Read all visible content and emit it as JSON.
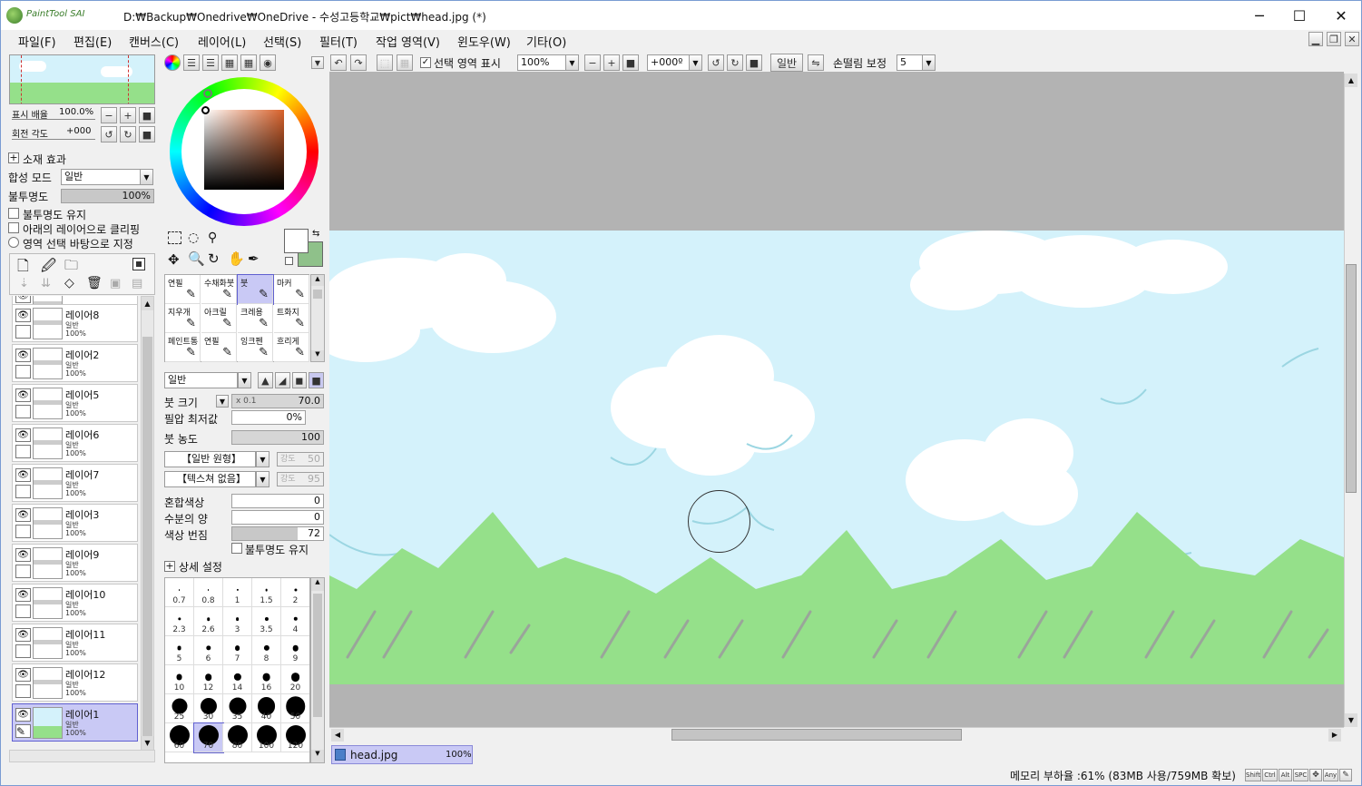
{
  "window": {
    "app_logo": "PaintTool SAI",
    "title": "D:₩Backup₩Onedrive₩OneDrive - 수성고등학교₩pict₩head.jpg (*)",
    "minimize_icon": "minimize-icon",
    "maximize_icon": "maximize-icon",
    "close_icon": "close-icon"
  },
  "menu": [
    "파일(F)",
    "편집(E)",
    "캔버스(C)",
    "레이어(L)",
    "선택(S)",
    "필터(T)",
    "작업 영역(V)",
    "윈도우(W)",
    "기타(O)"
  ],
  "navigator": {
    "zoom_label": "표시 배율",
    "zoom_value": "100.0%",
    "rotate_label": "회전 각도",
    "rotate_value": "+000"
  },
  "layer_props": {
    "effects_label": "소재 효과",
    "blend_label": "합성 모드",
    "blend_value": "일반",
    "opacity_label": "불투명도",
    "opacity_value": "100%",
    "opacity": 1.0,
    "preserve_opacity": "불투명도 유지",
    "clip_below": "아래의 레이어으로 클리핑",
    "selection_source": "영역 선택 바탕으로 지정"
  },
  "layers": [
    {
      "name": "",
      "mode": "",
      "opacity": "100%",
      "partial": true
    },
    {
      "name": "레이어8",
      "mode": "일반",
      "opacity": "100%"
    },
    {
      "name": "레이어2",
      "mode": "일반",
      "opacity": "100%"
    },
    {
      "name": "레이어5",
      "mode": "일반",
      "opacity": "100%"
    },
    {
      "name": "레이어6",
      "mode": "일반",
      "opacity": "100%"
    },
    {
      "name": "레이어7",
      "mode": "일반",
      "opacity": "100%"
    },
    {
      "name": "레이어3",
      "mode": "일반",
      "opacity": "100%"
    },
    {
      "name": "레이어9",
      "mode": "일반",
      "opacity": "100%"
    },
    {
      "name": "레이어10",
      "mode": "일반",
      "opacity": "100%"
    },
    {
      "name": "레이어11",
      "mode": "일반",
      "opacity": "100%"
    },
    {
      "name": "레이어12",
      "mode": "일반",
      "opacity": "100%"
    },
    {
      "name": "레이어1",
      "mode": "일반",
      "opacity": "100%",
      "selected": true
    }
  ],
  "tools": [
    [
      "연필",
      "수채화붓",
      "붓",
      "마커"
    ],
    [
      "지우개",
      "아크릴",
      "크레용",
      "트화지"
    ],
    [
      "페인트통",
      "연필",
      "잉크펜",
      "흐리게"
    ]
  ],
  "selected_tool": "붓",
  "brush": {
    "mode": "일반",
    "size_label": "붓 크기",
    "size_mult": "x 0.1",
    "size_value": "70.0",
    "min_pressure_label": "필압 최저값",
    "min_pressure_value": "0%",
    "density_label": "붓 농도",
    "density_value": "100",
    "shape": "【일반 원형】",
    "shape_strength_label": "강도",
    "shape_strength": "50",
    "texture": "【텍스쳐 없음】",
    "texture_strength_label": "강도",
    "texture_strength": "95",
    "blend_label": "혼합색상",
    "blend_value": "0",
    "water_label": "수분의 양",
    "water_value": "0",
    "persistence_label": "색상 번짐",
    "persistence_value": "72",
    "preserve_opacity": "불투명도 유지",
    "advanced_label": "상세 설정"
  },
  "brush_sizes": [
    "0.7",
    "0.8",
    "1",
    "1.5",
    "2",
    "2.3",
    "2.6",
    "3",
    "3.5",
    "4",
    "5",
    "6",
    "7",
    "8",
    "9",
    "10",
    "12",
    "14",
    "16",
    "20",
    "25",
    "30",
    "35",
    "40",
    "50",
    "60",
    "70",
    "80",
    "100",
    "120"
  ],
  "selected_brush_size": "70",
  "canvas_toolbar": {
    "show_selection": "선택 영역 표시",
    "zoom": "100%",
    "angle": "+000º",
    "mode": "일반",
    "stabilizer_label": "손떨림 보정",
    "stabilizer_value": "5"
  },
  "colors": {
    "primary": "#ffffff",
    "secondary": "#8fc18a",
    "sky": "#d4f2fb",
    "grass": "#95e08a",
    "canvas_bg": "#b3b3b3"
  },
  "document_tab": {
    "name": "head.jpg",
    "zoom": "100%"
  },
  "status": {
    "memory": "메모리 부하율 :61% (83MB 사용/759MB 확보)",
    "keys": [
      "Shift",
      "Ctrl",
      "Alt",
      "SPC",
      "Any"
    ]
  }
}
